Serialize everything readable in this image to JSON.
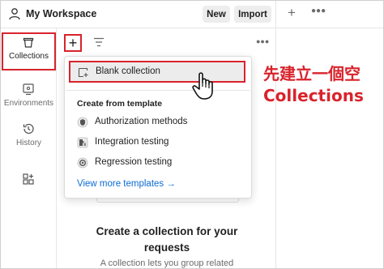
{
  "header": {
    "workspace_title": "My Workspace",
    "new_label": "New",
    "import_label": "Import",
    "workspace_icon": "user-icon",
    "add_tab_icon": "plus-icon",
    "more_icon": "ellipsis-icon"
  },
  "sidebar": {
    "items": [
      {
        "label": "Collections",
        "icon": "trash-box-icon",
        "active": true
      },
      {
        "label": "Environments",
        "icon": "environment-icon",
        "active": false
      },
      {
        "label": "History",
        "icon": "history-icon",
        "active": false
      },
      {
        "label": "",
        "icon": "grid-plus-icon",
        "active": false
      }
    ]
  },
  "panel": {
    "add_icon": "plus-icon",
    "filter_icon": "filter-icon",
    "more_icon": "ellipsis-icon"
  },
  "dropdown": {
    "blank_collection": "Blank collection",
    "template_heading": "Create from template",
    "templates": [
      {
        "label": "Authorization methods",
        "icon": "shield-icon"
      },
      {
        "label": "Integration testing",
        "icon": "puzzle-icon"
      },
      {
        "label": "Regression testing",
        "icon": "gear-target-icon"
      }
    ],
    "view_more_link": "View more templates →"
  },
  "empty_state": {
    "title_line1": "Create a collection for your",
    "title_line2": "requests",
    "subtitle": "A collection lets you group related"
  },
  "annotation": {
    "line1": "先建立一個空",
    "line2": "Collections"
  },
  "colors": {
    "highlight_red": "#d9232c",
    "link_blue": "#0b6bd3",
    "text": "#212121",
    "muted": "#6b6b6b"
  }
}
